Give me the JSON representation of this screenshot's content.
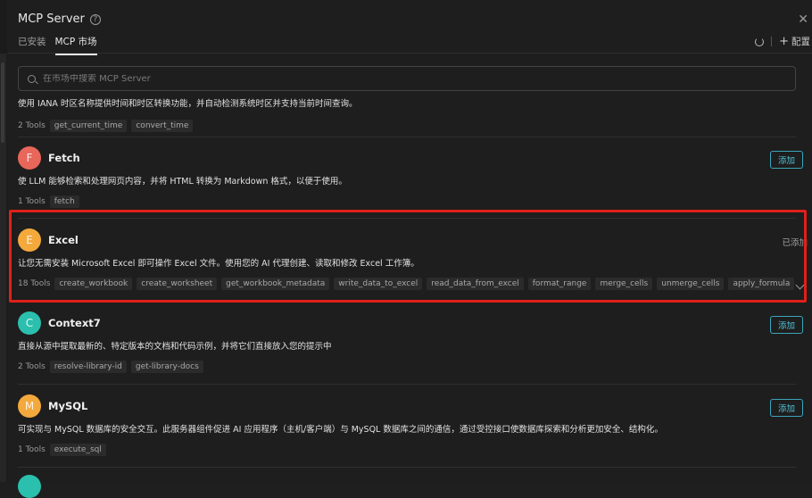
{
  "header": {
    "title": "MCP Server",
    "tabs": [
      {
        "label": "已安装"
      },
      {
        "label": "MCP 市场"
      }
    ],
    "config_label": "配置"
  },
  "search": {
    "placeholder": "在市场中搜索 MCP Server"
  },
  "servers": [
    {
      "desc": "使用 IANA 时区名称提供时间和时区转换功能，并自动检测系统时区并支持当前时间查询。",
      "tool_count": "2 Tools",
      "tools": [
        "get_current_time",
        "convert_time"
      ]
    },
    {
      "name": "Fetch",
      "initial": "F",
      "color": "#e8665a",
      "action": "添加",
      "desc": "使 LLM 能够检索和处理网页内容，并将 HTML 转换为 Markdown 格式，以便于使用。",
      "tool_count": "1 Tools",
      "tools": [
        "fetch"
      ]
    },
    {
      "name": "Excel",
      "initial": "E",
      "color": "#f3a93c",
      "action": "已添加",
      "desc": "让您无需安装 Microsoft Excel 即可操作 Excel 文件。使用您的 AI 代理创建、读取和修改 Excel 工作簿。",
      "tool_count": "18 Tools",
      "tools": [
        "create_workbook",
        "create_worksheet",
        "get_workbook_metadata",
        "write_data_to_excel",
        "read_data_from_excel",
        "format_range",
        "merge_cells",
        "unmerge_cells",
        "apply_formula"
      ]
    },
    {
      "name": "Context7",
      "initial": "C",
      "color": "#2bbfae",
      "action": "添加",
      "desc": "直接从源中提取最新的、特定版本的文档和代码示例，并将它们直接放入您的提示中",
      "tool_count": "2 Tools",
      "tools": [
        "resolve-library-id",
        "get-library-docs"
      ]
    },
    {
      "name": "MySQL",
      "initial": "M",
      "color": "#f3a93c",
      "action": "添加",
      "desc": "可实现与 MySQL 数据库的安全交互。此服务器组件促进 AI 应用程序（主机/客户端）与 MySQL 数据库之间的通信，通过受控接口使数据库探索和分析更加安全、结构化。",
      "tool_count": "1 Tools",
      "tools": [
        "execute_sql"
      ]
    }
  ],
  "colors": {
    "accent": "#4fc1d6",
    "highlight": "#e0201a",
    "panel": "#1e1e1e"
  },
  "icons": {
    "help": "question-circle-icon",
    "close": "close-icon",
    "refresh": "refresh-icon",
    "add": "plus-icon",
    "search": "search-icon",
    "expand": "chevron-down-icon"
  }
}
